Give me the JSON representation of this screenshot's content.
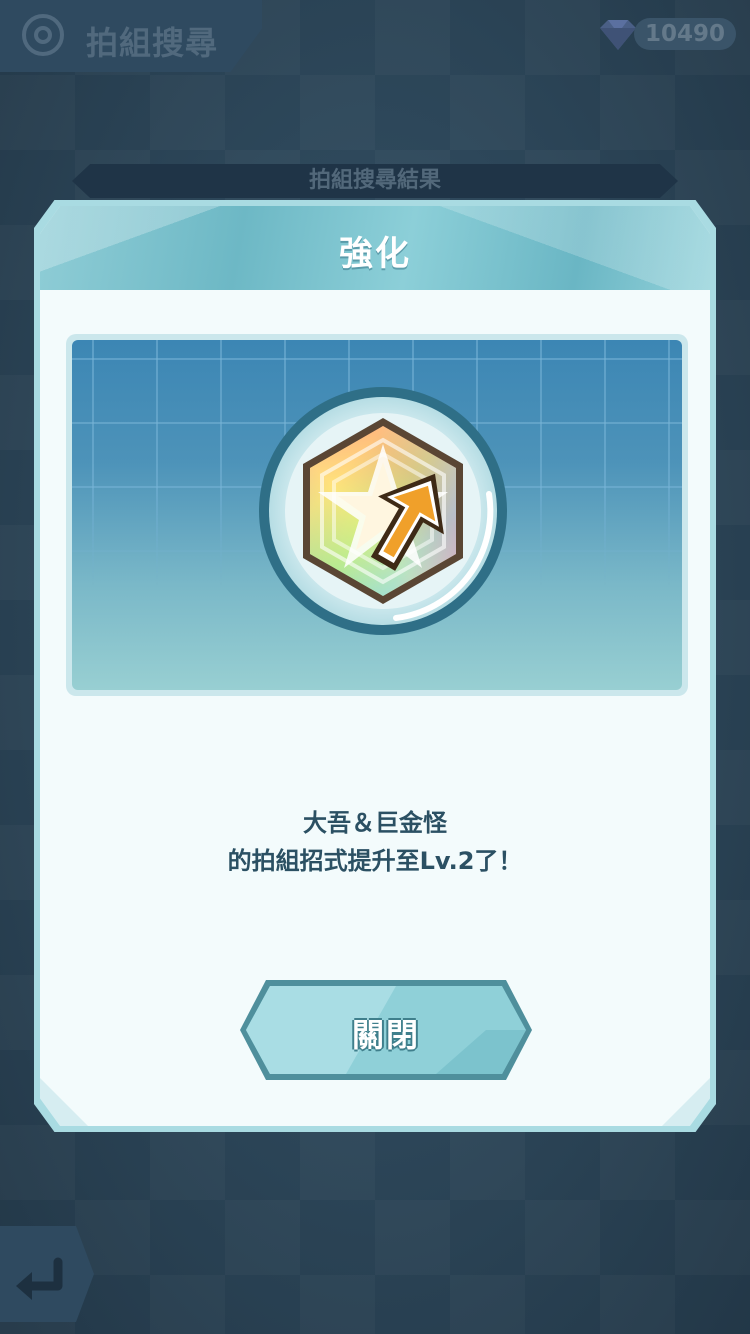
{
  "header": {
    "title": "拍組搜尋",
    "gem_count": "10490"
  },
  "ribbon": {
    "label": "拍組搜尋結果"
  },
  "dialog": {
    "title": "強化",
    "message_line1": "大吾＆巨金怪",
    "message_line2": "的拍組招式提升至Lv.2了！",
    "close_label": "關閉"
  },
  "icons": {
    "top_tab": "sync-pair-scout-icon",
    "gem": "gem-icon",
    "badge": "move-level-up-badge-icon",
    "back": "back-arrow-icon"
  },
  "colors": {
    "panel_border": "#a9dbe2",
    "title_text": "#ffffff",
    "message_text": "#2b5063",
    "button_fill": "#8fd0d8",
    "arrow_orange": "#f0a02a"
  }
}
